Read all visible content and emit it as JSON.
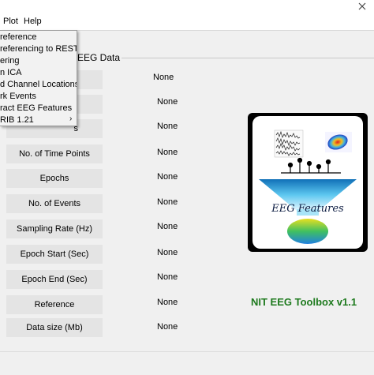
{
  "menubar": {
    "plot": "Plot",
    "help": "Help"
  },
  "panel": {
    "title": "EEG Data"
  },
  "dropdown": {
    "items": [
      "reference",
      "referencing to REST",
      "ering",
      "n ICA",
      "d Channel Locations",
      "rk Events",
      "ract EEG Features",
      "RIB 1.21"
    ]
  },
  "fields": [
    {
      "label": "",
      "value": "None"
    },
    {
      "label": "",
      "value": "None"
    },
    {
      "label": "s",
      "value": "None"
    },
    {
      "label": "No. of Time Points",
      "value": "None"
    },
    {
      "label": "Epochs",
      "value": "None"
    },
    {
      "label": "No. of Events",
      "value": "None"
    },
    {
      "label": "Sampling Rate (Hz)",
      "value": "None"
    },
    {
      "label": "Epoch Start (Sec)",
      "value": "None"
    },
    {
      "label": "Epoch End (Sec)",
      "value": "None"
    },
    {
      "label": "Reference",
      "value": "None"
    },
    {
      "label": "Data size (Mb)",
      "value": "None"
    }
  ],
  "logo": {
    "caption": "EEG Features"
  },
  "toolbox": {
    "title": "NIT EEG Toolbox v1.1"
  },
  "colors": {
    "title_green": "#1e7a1e",
    "logo_frame": "#000000",
    "funnel": "#3aa8e0"
  },
  "icons": {
    "close": "close-icon",
    "submenu": "chevron-right-icon"
  }
}
